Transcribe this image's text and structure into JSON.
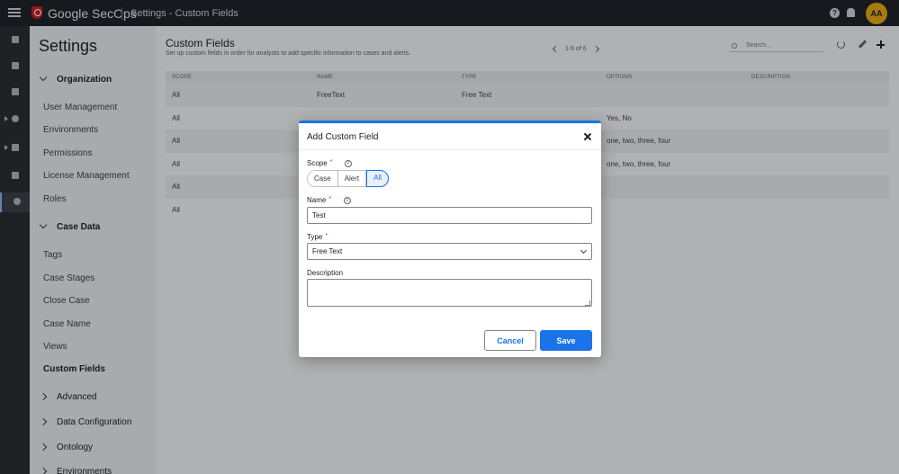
{
  "topbar": {
    "brand": "Google SecOps",
    "breadcrumb": "Settings - Custom Fields",
    "help_glyph": "?",
    "avatar_initials": "AA"
  },
  "rail": {
    "icons": [
      "folder-icon",
      "cases-icon",
      "folder-icon",
      "gear-icon",
      "chart-icon",
      "storage-icon",
      "settings-icon"
    ]
  },
  "sidebar": {
    "title": "Settings",
    "organization": {
      "label": "Organization",
      "items": [
        "User Management",
        "Environments",
        "Permissions",
        "License Management",
        "Roles"
      ]
    },
    "case_data": {
      "label": "Case Data",
      "items": [
        "Tags",
        "Case Stages",
        "Close Case",
        "Case Name",
        "Views",
        "Custom Fields"
      ],
      "active": "Custom Fields"
    },
    "collapsed_sections": [
      "Advanced",
      "Data Configuration",
      "Ontology",
      "Environments"
    ]
  },
  "main": {
    "title": "Custom Fields",
    "subtitle": "Set up custom fields in order for analysts to add specific information to cases and alerts.",
    "pager": "1-6 of 6",
    "search_placeholder": "Search...",
    "table": {
      "headers": [
        "SCOPE",
        "NAME",
        "TYPE",
        "OPTIONS",
        "DESCRIPTION"
      ],
      "rows": [
        [
          "All",
          "FreeText",
          "Free Text",
          "",
          ""
        ],
        [
          "All",
          "",
          "",
          "Yes, No",
          ""
        ],
        [
          "All",
          "",
          "",
          "one, two, three, four",
          ""
        ],
        [
          "All",
          "",
          "",
          "one, two, three, four",
          ""
        ],
        [
          "All",
          "",
          "",
          "",
          ""
        ],
        [
          "All",
          "",
          "",
          "",
          ""
        ]
      ]
    }
  },
  "dialog": {
    "title": "Add Custom Field",
    "scope_label": "Scope",
    "required_mark": "*",
    "info_glyph": "i",
    "scope_options": [
      "Case",
      "Alert",
      "All"
    ],
    "scope_selected": "All",
    "name_label": "Name",
    "name_value": "Test",
    "type_label": "Type",
    "type_value": "Free Text",
    "description_label": "Description",
    "description_value": "",
    "cancel_label": "Cancel",
    "save_label": "Save"
  },
  "colors": {
    "accent": "#1a73e8",
    "topbar": "#1f2328",
    "avatar": "#e6a817",
    "required": "#d93025"
  }
}
